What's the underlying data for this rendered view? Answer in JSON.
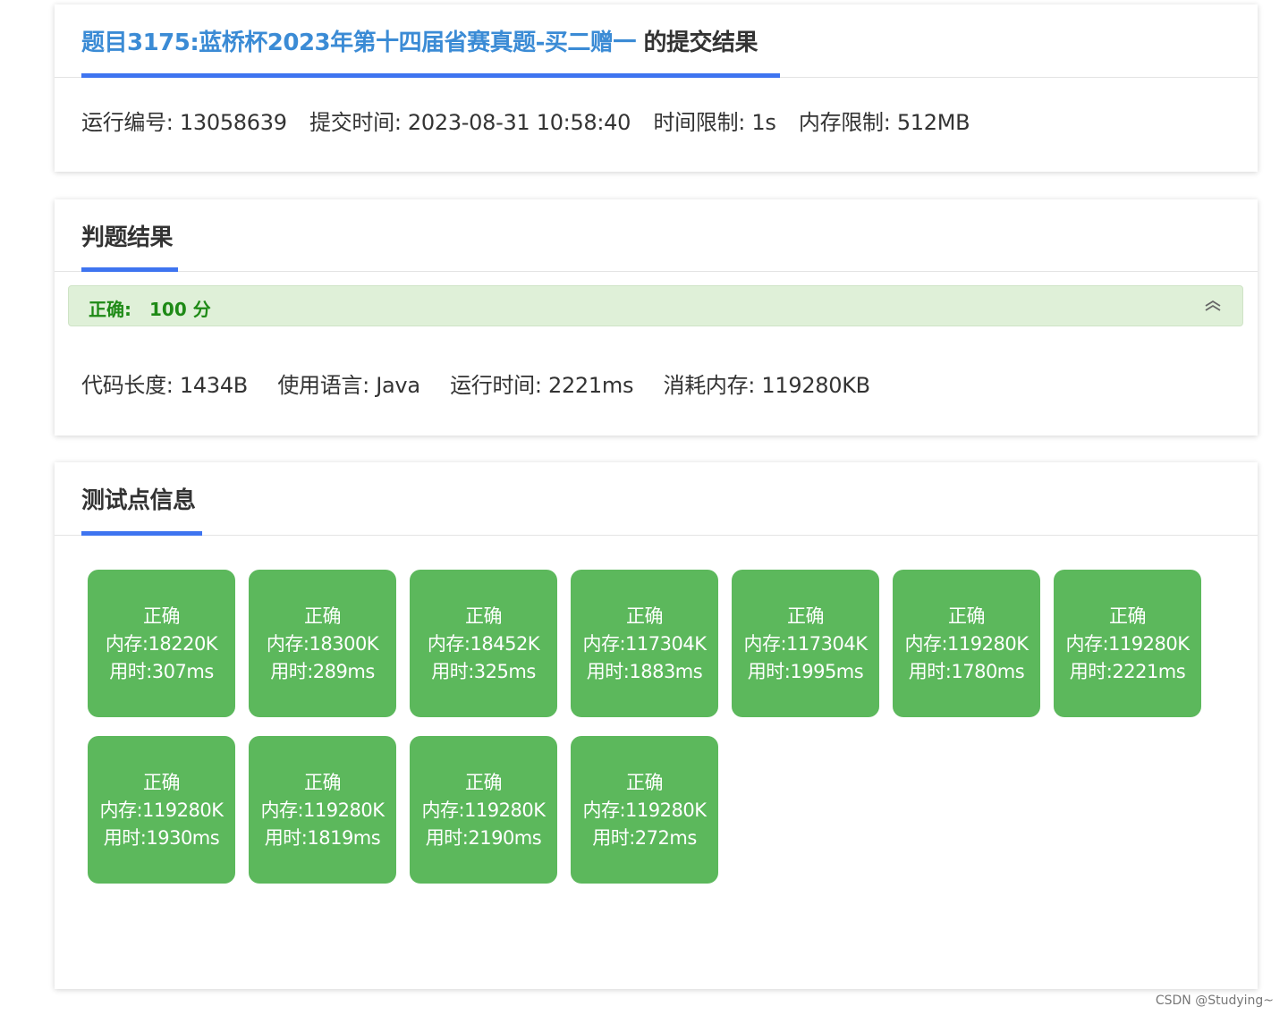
{
  "submission": {
    "problem_title": "题目3175:蓝桥杯2023年第十四届省赛真题-买二赠一",
    "title_suffix": " 的提交结果",
    "run_id": "运行编号: 13058639",
    "submit_time": "提交时间: 2023-08-31 10:58:40",
    "time_limit": "时间限制: 1s",
    "memory_limit": "内存限制: 512MB"
  },
  "judge": {
    "heading": "判题结果",
    "verdict_label": "正确:",
    "verdict_score": "100 分",
    "code_length": "代码长度: 1434B",
    "language": "使用语言: Java",
    "run_time": "运行时间: 2221ms",
    "memory_used": "消耗内存: 119280KB"
  },
  "tests": {
    "heading": "测试点信息",
    "items": [
      {
        "status": "正确",
        "memory": "内存:18220K",
        "time": "用时:307ms"
      },
      {
        "status": "正确",
        "memory": "内存:18300K",
        "time": "用时:289ms"
      },
      {
        "status": "正确",
        "memory": "内存:18452K",
        "time": "用时:325ms"
      },
      {
        "status": "正确",
        "memory": "内存:117304K",
        "time": "用时:1883ms"
      },
      {
        "status": "正确",
        "memory": "内存:117304K",
        "time": "用时:1995ms"
      },
      {
        "status": "正确",
        "memory": "内存:119280K",
        "time": "用时:1780ms"
      },
      {
        "status": "正确",
        "memory": "内存:119280K",
        "time": "用时:2221ms"
      },
      {
        "status": "正确",
        "memory": "内存:119280K",
        "time": "用时:1930ms"
      },
      {
        "status": "正确",
        "memory": "内存:119280K",
        "time": "用时:1819ms"
      },
      {
        "status": "正确",
        "memory": "内存:119280K",
        "time": "用时:2190ms"
      },
      {
        "status": "正确",
        "memory": "内存:119280K",
        "time": "用时:272ms"
      }
    ]
  },
  "watermark": "CSDN @Studying~",
  "colors": {
    "accent_underline": "#3e74f0",
    "link_blue": "#3b8bd5",
    "success_green": "#5cb85c",
    "verdict_bg": "#dff0d8",
    "verdict_text": "#1e8a16"
  },
  "icons": {
    "collapse": "chevron-double-up-icon"
  }
}
